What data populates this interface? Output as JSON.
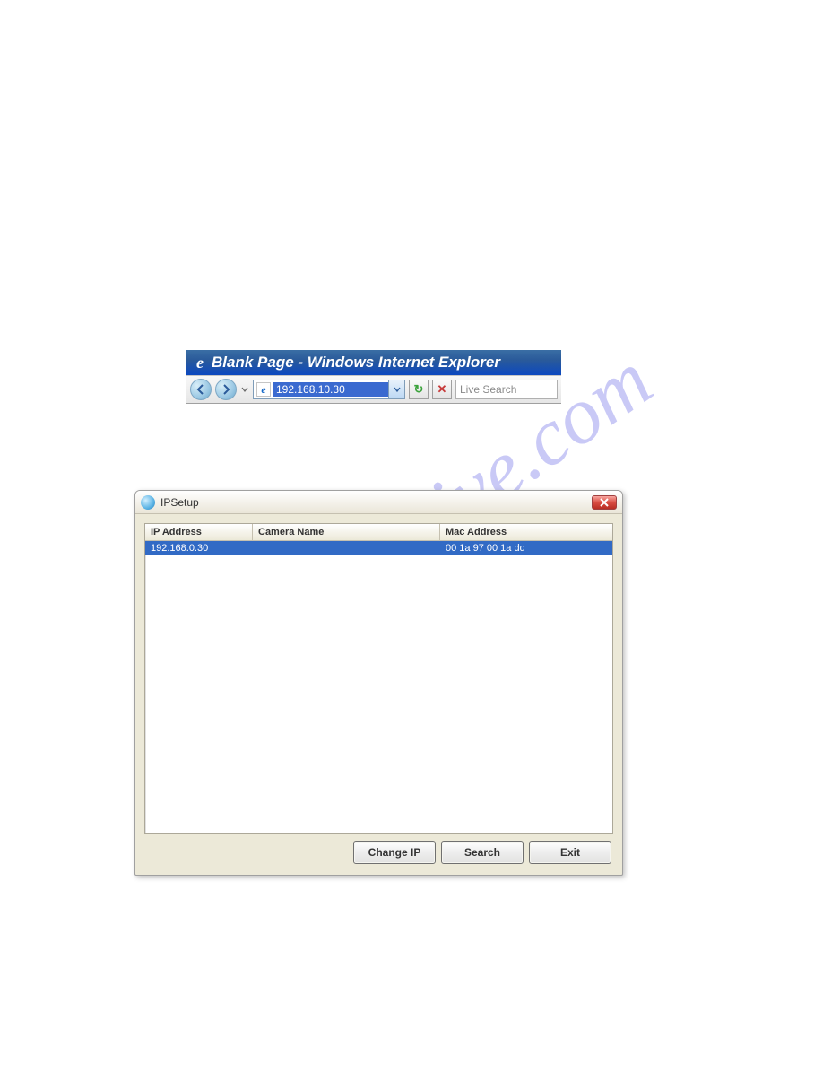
{
  "watermark": "manualshive.com",
  "ie": {
    "title": "Blank Page - Windows Internet Explorer",
    "address_value": "192.168.10.30",
    "search_placeholder": "Live Search"
  },
  "ipsetup": {
    "title": "IPSetup",
    "columns": {
      "ip": "IP Address",
      "name": "Camera Name",
      "mac": "Mac Address"
    },
    "rows": [
      {
        "ip": "192.168.0.30",
        "name": "",
        "mac": "00 1a 97 00 1a dd"
      }
    ],
    "buttons": {
      "change_ip": "Change IP",
      "search": "Search",
      "exit": "Exit"
    }
  }
}
